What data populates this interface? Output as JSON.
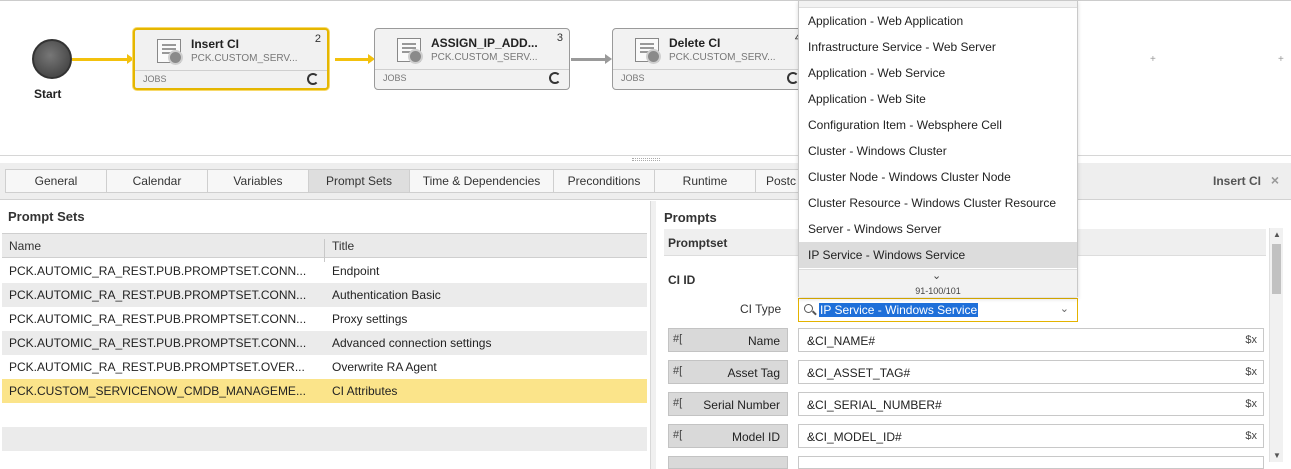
{
  "workflow": {
    "start_label": "Start",
    "tasks": [
      {
        "name": "Insert CI",
        "object": "PCK.CUSTOM_SERV...",
        "number": "2",
        "type": "JOBS"
      },
      {
        "name": "ASSIGN_IP_ADD...",
        "object": "PCK.CUSTOM_SERV...",
        "number": "3",
        "type": "JOBS"
      },
      {
        "name": "Delete CI",
        "object": "PCK.CUSTOM_SERV...",
        "number": "4",
        "type": "JOBS"
      }
    ],
    "plus_glyph": "+"
  },
  "tabs": {
    "items": [
      "General",
      "Calendar",
      "Variables",
      "Prompt Sets",
      "Time & Dependencies",
      "Preconditions",
      "Runtime",
      "Postc"
    ],
    "selected": "Prompt Sets",
    "panel_title": "Insert CI",
    "close_glyph": "×"
  },
  "prompt_sets": {
    "title": "Prompt Sets",
    "columns": [
      "Name",
      "Title"
    ],
    "rows": [
      {
        "name": "PCK.AUTOMIC_RA_REST.PUB.PROMPTSET.CONN...",
        "title": "Endpoint"
      },
      {
        "name": "PCK.AUTOMIC_RA_REST.PUB.PROMPTSET.CONN...",
        "title": "Authentication Basic"
      },
      {
        "name": "PCK.AUTOMIC_RA_REST.PUB.PROMPTSET.CONN...",
        "title": "Proxy settings"
      },
      {
        "name": "PCK.AUTOMIC_RA_REST.PUB.PROMPTSET.CONN...",
        "title": "Advanced connection settings"
      },
      {
        "name": "PCK.AUTOMIC_RA_REST.PUB.PROMPTSET.OVER...",
        "title": "Overwrite RA Agent"
      },
      {
        "name": "PCK.CUSTOM_SERVICENOW_CMDB_MANAGEME...",
        "title": "CI Attributes"
      }
    ]
  },
  "prompts": {
    "title": "Prompts",
    "promptset_label": "Promptset",
    "ci_id_label": "CI ID",
    "ci_type_label": "CI Type",
    "ci_type_value": "IP Service - Windows Service",
    "fields": [
      {
        "label": "Name",
        "value": "&CI_NAME#",
        "var_glyph": "$x",
        "hash_glyph": "#["
      },
      {
        "label": "Asset Tag",
        "value": "&CI_ASSET_TAG#",
        "var_glyph": "$x",
        "hash_glyph": "#["
      },
      {
        "label": "Serial Number",
        "value": "&CI_SERIAL_NUMBER#",
        "var_glyph": "$x",
        "hash_glyph": "#["
      },
      {
        "label": "Model ID",
        "value": "&CI_MODEL_ID#",
        "var_glyph": "$x",
        "hash_glyph": "#["
      }
    ]
  },
  "dropdown": {
    "options": [
      "Application - Web Application",
      "Infrastructure Service - Web Server",
      "Application - Web Service",
      "Application - Web Site",
      "Configuration Item - Websphere Cell",
      "Cluster - Windows Cluster",
      "Cluster Node - Windows Cluster Node",
      "Cluster Resource - Windows Cluster Resource",
      "Server - Windows Server",
      "IP Service - Windows Service"
    ],
    "highlighted": "IP Service - Windows Service",
    "pagination": "91-100/101"
  },
  "colors": {
    "accent": "#f3c10d",
    "selection": "#fbe48a",
    "highlight": "#1e6fd9"
  }
}
